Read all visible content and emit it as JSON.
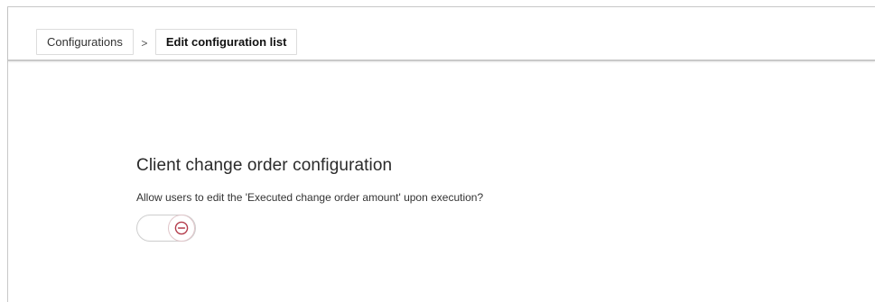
{
  "breadcrumb": {
    "items": [
      {
        "label": "Configurations"
      },
      {
        "label": "Edit configuration list"
      }
    ],
    "separator": ">"
  },
  "section": {
    "title": "Client change order configuration",
    "question": "Allow users to edit the 'Executed change order amount' upon execution?",
    "toggle": {
      "state": "off",
      "icon": "minus-circle-icon",
      "icon_color": "#b33a4a"
    }
  }
}
